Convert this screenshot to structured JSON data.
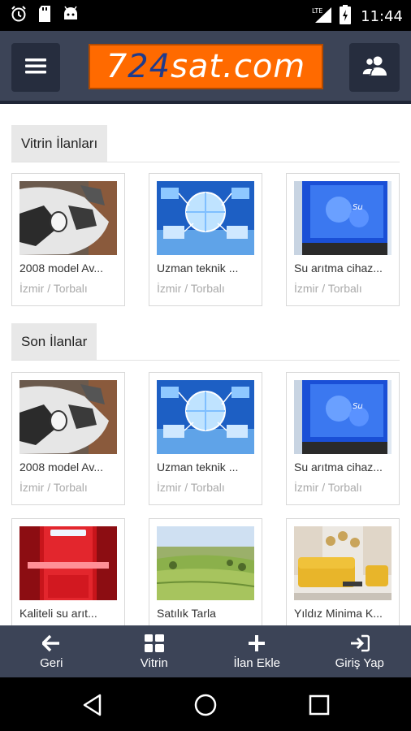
{
  "status_bar": {
    "time": "11:44",
    "network": "LTE",
    "left_icons": [
      "alarm-icon",
      "sd-card-icon",
      "android-icon"
    ],
    "right_icons": [
      "signal-icon",
      "battery-icon"
    ]
  },
  "header": {
    "logo_part1": "7",
    "logo_part2": "24",
    "logo_part3": "sat.com",
    "menu_icon": "hamburger-icon",
    "user_icon": "users-icon"
  },
  "sections": {
    "vitrin_title": "Vitrin İlanları",
    "son_title": "Son İlanlar"
  },
  "vitrin_listings": [
    {
      "title": "2008 model Av...",
      "location": "İzmir / Torbalı",
      "image": "car"
    },
    {
      "title": "Uzman teknik ...",
      "location": "İzmir / Torbalı",
      "image": "network"
    },
    {
      "title": "Su arıtma cihaz...",
      "location": "İzmir / Torbalı",
      "image": "water"
    }
  ],
  "son_listings": [
    {
      "title": "2008 model Av...",
      "location": "İzmir / Torbalı",
      "image": "car"
    },
    {
      "title": "Uzman teknik ...",
      "location": "İzmir / Torbalı",
      "image": "network"
    },
    {
      "title": "Su arıtma cihaz...",
      "location": "İzmir / Torbalı",
      "image": "water"
    },
    {
      "title": "Kaliteli su arıt...",
      "location": "",
      "image": "red-filter"
    },
    {
      "title": "Satılık Tarla",
      "location": "",
      "image": "field"
    },
    {
      "title": "Yıldız Minima K...",
      "location": "",
      "image": "sofa"
    }
  ],
  "bottom_nav": [
    {
      "label": "Geri",
      "icon": "arrow-left-icon"
    },
    {
      "label": "Vitrin",
      "icon": "grid-icon"
    },
    {
      "label": "İlan Ekle",
      "icon": "plus-icon"
    },
    {
      "label": "Giriş Yap",
      "icon": "sign-in-icon"
    }
  ],
  "system_nav": [
    "back-icon",
    "home-icon",
    "recents-icon"
  ],
  "colors": {
    "header": "#3c4457",
    "button_dark": "#262d3e",
    "logo_orange": "#ff6a00",
    "logo_blue": "#1f3b8c",
    "section_bg": "#e8e8e8"
  }
}
